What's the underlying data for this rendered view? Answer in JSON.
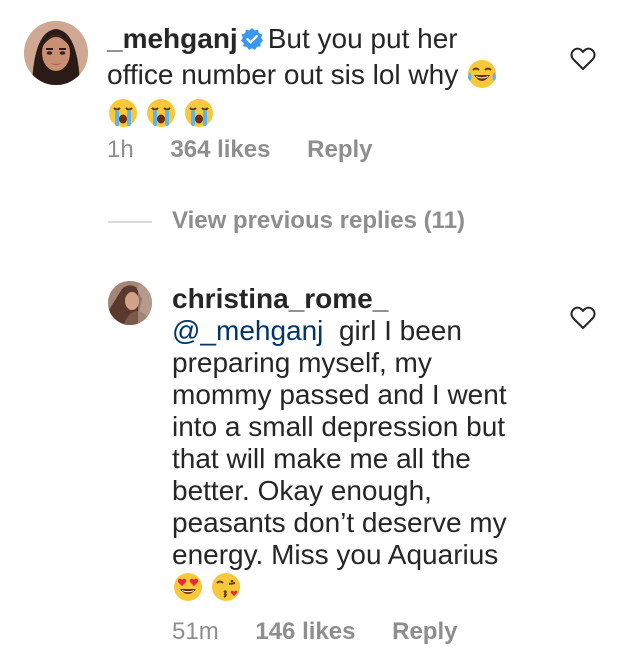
{
  "comment": {
    "username": "_mehganj",
    "text_line1": "But you put her",
    "text_line2": "office number out sis lol why",
    "emoji_inline": "face-with-tears-of-joy",
    "emoji_row": [
      "loudly-crying-face",
      "loudly-crying-face",
      "loudly-crying-face"
    ],
    "time": "1h",
    "likes": "364 likes",
    "reply_label": "Reply"
  },
  "view_previous": "View previous replies (11)",
  "reply": {
    "username": "christina_rome_",
    "mention": "@_mehganj",
    "text_first": "girl I been",
    "text_lines": [
      "preparing myself, my",
      "mommy passed and I went",
      "into a small depression but",
      "that will make me all the",
      "better. Okay enough,",
      "peasants don’t deserve my",
      "energy. Miss you Aquarius"
    ],
    "emoji_row": [
      "smiling-face-with-heart-eyes",
      "face-blowing-a-kiss"
    ],
    "time": "51m",
    "likes": "146 likes",
    "reply_label": "Reply"
  },
  "colors": {
    "text": "#262626",
    "secondary": "#8e8e8e",
    "mention": "#003569",
    "verified": "#3897f0",
    "divider": "#dbdbdb"
  }
}
